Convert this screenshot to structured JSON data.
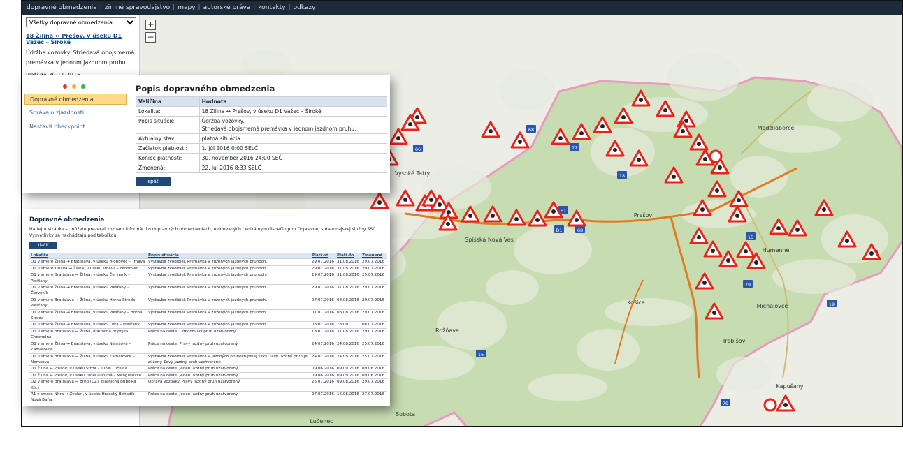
{
  "topnav": [
    "dopravné obmedzenia",
    "zimné spravodajstvo",
    "mapy",
    "autorské práva",
    "kontakty",
    "odkazy"
  ],
  "sidepanel": {
    "select_value": "Všetky dopravné obmedzenia",
    "link": "18 Žilina ↔ Prešov, v úseku D1 Važec – Široké",
    "description": "Údržba vozovky. Striedavá obojsmerná premávka v jednom jazdnom pruhu.",
    "valid": "Platí do 30.11.2016."
  },
  "zoom": {
    "plus": "+",
    "minus": "−"
  },
  "map": {
    "places": [
      {
        "name": "Vysoké Tatry"
      },
      {
        "name": "Prešov"
      },
      {
        "name": "Spišská Nová Ves"
      },
      {
        "name": "Košice"
      },
      {
        "name": "Rožňava"
      },
      {
        "name": "Trebišov"
      },
      {
        "name": "Michalovce"
      },
      {
        "name": "Humenné"
      },
      {
        "name": "Lučenec"
      },
      {
        "name": "Sobota"
      },
      {
        "name": "Medzilaborce"
      },
      {
        "name": "Kapušany"
      }
    ],
    "road_labels": [
      "68",
      "77",
      "66",
      "18",
      "15",
      "79",
      "19",
      "74",
      "65",
      "68",
      "16",
      "75",
      "79",
      "D1",
      "E1"
    ],
    "colors": {
      "border": "#e89ac0",
      "road": "#e07b22",
      "sign": "#e8231c",
      "forest": "#c7dcb0"
    }
  },
  "card1": {
    "menu": [
      "Dopravné obmedzenia",
      "Správa o zjazdnosti",
      "Nastaviť checkpoint"
    ],
    "title": "Popis dopravného obmedzenia",
    "header": [
      "Veličina",
      "Hodnota"
    ],
    "rows": [
      [
        "Lokalita:",
        "18 Žilina ↔ Prešov, v úseku D1 Važec – Široké"
      ],
      [
        "Popis situácie:",
        "Údržba vozovky.\nStriedavá obojsmerná premávka v jednom jazdnom pruhu."
      ],
      [
        "Aktuálny stav:",
        "platná situácia"
      ],
      [
        "Začiatok platnosti:",
        "1. júl 2016 0:00 SELČ"
      ],
      [
        "Koniec platnosti:",
        "30. november 2016 24:00 SEČ"
      ],
      [
        "Zmenená:",
        "22. júl 2016 8:33 SELČ"
      ]
    ],
    "back": "späť"
  },
  "card2": {
    "title": "Dopravné obmedzenia",
    "intro": "Na tejto stránke si môžete prezerať zoznam informácií o dopravných obmedzeniach, evidovaných centrálnym dispečingom Dopravnej spravodajskej služby SSC. Vysvetlivky sa nachádzajú pod tabuľkou.",
    "print": "tlačiť",
    "columns": [
      "Lokalita",
      "Popis situácie",
      "Platí od",
      "Platí do",
      "Zmenená"
    ],
    "rows": [
      [
        "D1 v smere Žilina → Bratislava, v úseku Hlohovec – Trnava",
        "Výstavba zvodidiel. Premávka v zúžených jazdných pruhoch.",
        "29.07.2016",
        "31.08.2016",
        "29.07.2016"
      ],
      [
        "D1 v smere Trnava → Žilina, v úseku Trnava – Hlohovec",
        "Výstavba zvodidiel. Premávka v zúžených jazdných pruhoch.",
        "29.07.2016",
        "31.08.2016",
        "29.07.2016"
      ],
      [
        "D1 v smere Bratislava → Žilina, v úseku Červeník – Piešťany",
        "Výstavba zvodidiel. Premávka v zúžených jazdných pruhoch.",
        "29.07.2016",
        "31.08.2016",
        "29.07.2016"
      ],
      [
        "D1 v smere Žilina → Bratislava, v úseku Piešťany – Červeník",
        "Výstavba zvodidiel. Premávka v zúžených jazdných pruhoch.",
        "29.07.2016",
        "31.08.2016",
        "29.07.2016"
      ],
      [
        "D1 v smere Bratislava → Žilina, v úseku Horná Streda – Piešťany",
        "Výstavba zvodidiel. Premávka v zúžených jazdných pruhoch.",
        "07.07.2016",
        "08.08.2016",
        "29.07.2016"
      ],
      [
        "D1 v smere Žilina → Bratislava, v úseku Piešťany – Horná Streda",
        "Výstavba zvodidiel. Premávka v zúžených jazdných pruhoch.",
        "07.07.2016",
        "08.08.2016",
        "29.07.2016"
      ],
      [
        "D1 v smere Žilina → Bratislava, v úseku Lúka – Piešťany",
        "Výstavba zvodidiel. Premávka v zúžených jazdných pruhoch.",
        "08.07.2016",
        "18:00",
        "08.07.2016"
      ],
      [
        "D1 v smere Bratislava → Žilina, diaľničná prípojka Chocholná",
        "Práce na ceste. Odbočovací pruh uzatvorený.",
        "18.07.2016",
        "31.08.2016",
        "29.07.2016"
      ],
      [
        "D1 v smere Žilina → Bratislava, v úseku Nemšová – Zamarovce",
        "Práce na ceste. Pravý jazdný pruh uzatvorený.",
        "24.07.2016",
        "24.08.2016",
        "25.07.2016"
      ],
      [
        "D1 v smere Bratislava → Žilina, v úseku Zamarovce – Nemšová",
        "Výstavba zvodidiel. Premávka v jazdných pruhoch plnej šírky, ľavý jazdný pruh je zúžený. Ľavý jazdný pruh uzatvorený.",
        "24.07.2016",
        "24.08.2016",
        "25.07.2016"
      ],
      [
        "D1 Žilina ↔ Prešov, v úseku Štrba – Tunel Lučivná",
        "Práce na ceste. Jeden jazdný pruh uzatvorený.",
        "09.06.2016",
        "09.09.2016",
        "09.06.2016"
      ],
      [
        "D1 Žilina ↔ Prešov, v úseku Tunel Lučivná – Mengusovce",
        "Práce na ceste. Jeden jazdný pruh uzatvorený.",
        "09.06.2016",
        "09.09.2016",
        "09.06.2016"
      ],
      [
        "D2 v smere Bratislava → Brno (CZ), diaľničná prípojka Kúty",
        "Oprava vozovky. Pravý jazdný pruh uzatvorený.",
        "25.07.2016",
        "09.08.2016",
        "29.07.2016"
      ],
      [
        "R1 v smere Nitra → Zvolen, v úseku Hronský Beňadik – Nová Baňa",
        "Práce na ceste. Jeden jazdný pruh uzatvorený.",
        "27.07.2016",
        "16.08.2016",
        "27.07.2016"
      ]
    ]
  }
}
